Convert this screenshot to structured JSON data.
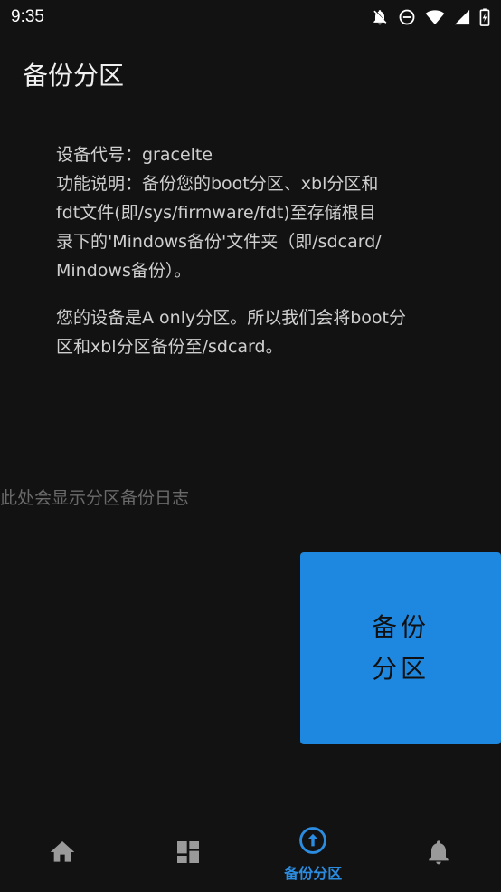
{
  "status_bar": {
    "time": "9:35",
    "icons": [
      "notifications-off-icon",
      "do-not-disturb-icon",
      "wifi-icon",
      "cell-signal-icon",
      "battery-charging-icon"
    ]
  },
  "app": {
    "title": "备份分区"
  },
  "info": {
    "device_line": "设备代号：gracelte",
    "desc_line1": "功能说明：备份您的boot分区、xbl分区和",
    "desc_line2": "fdt文件(即/sys/firmware/fdt)至存储根目",
    "desc_line3": "录下的'Mindows备份'文件夹（即/sdcard/",
    "desc_line4": "Mindows备份）。",
    "note_line1": "您的设备是A only分区。所以我们会将boot分",
    "note_line2": "区和xbl分区备份至/sdcard。"
  },
  "log": {
    "placeholder": "此处会显示分区备份日志"
  },
  "backup_button": {
    "label": "备份分区"
  },
  "bottom_nav": {
    "items": [
      {
        "icon": "home-icon",
        "label": ""
      },
      {
        "icon": "dashboard-icon",
        "label": ""
      },
      {
        "icon": "upload-circle-icon",
        "label": "备份分区",
        "active": true
      },
      {
        "icon": "bell-icon",
        "label": ""
      }
    ]
  },
  "colors": {
    "background": "#121212",
    "accent": "#1e87e0",
    "nav_active": "#2b8ce0",
    "nav_inactive": "#9a9a9a"
  }
}
